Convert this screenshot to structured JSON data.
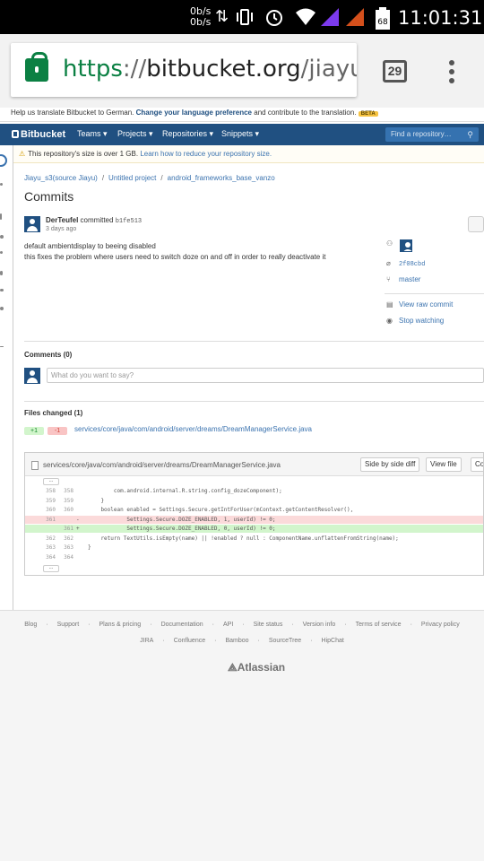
{
  "status_bar": {
    "net_up": "0b/s",
    "net_down": "0b/s",
    "battery": "68",
    "time": "11:01:31",
    "icons": [
      "data-transfer-icon",
      "vibrate-icon",
      "alarm-icon",
      "wifi-icon",
      "signal-icon",
      "signal-icon",
      "battery-icon"
    ]
  },
  "browser": {
    "url_scheme": "https",
    "url_sep": "://",
    "url_host": "bitbucket.org",
    "url_path": "/jiayu_s",
    "tab_count": "29",
    "icons": [
      "lock-icon",
      "menu-dots-icon"
    ]
  },
  "translate_bar": {
    "prefix": "Help us translate Bitbucket to German.",
    "link": "Change your language preference",
    "suffix": "and contribute to the translation.",
    "badge": "BETA"
  },
  "nav": {
    "logo": "Bitbucket",
    "items": [
      "Teams ▾",
      "Projects ▾",
      "Repositories ▾",
      "Snippets ▾"
    ],
    "search_placeholder": "Find a repository…",
    "brand_color": "#205081"
  },
  "warning": {
    "text": "This repository's size is over 1 GB.",
    "link": "Learn how to reduce your repository size."
  },
  "breadcrumb": {
    "items": [
      "Jiayu_s3(source Jiayu)",
      "Untitled project",
      "android_frameworks_base_vanzo"
    ],
    "sep": "/"
  },
  "page_title": "Commits",
  "commit": {
    "author": "DerTeufel",
    "verb": "committed",
    "hash": "b1fe513",
    "date": "3 days ago",
    "message_line1": "default ambientdisplay to beeing disabled",
    "message_line2": "this fixes the problem where users need to switch doze on and off in order to really deactivate it",
    "sidebar": {
      "parent_hash": "2f08cbd",
      "branch": "master",
      "view_raw": "View raw commit",
      "stop_watching": "Stop watching"
    }
  },
  "comments": {
    "heading": "Comments (0)",
    "placeholder": "What do you want to say?"
  },
  "files_changed": {
    "heading": "Files changed (1)",
    "added": "+1",
    "removed": "-1",
    "file": "services/core/java/com/android/server/dreams/DreamManagerService.java"
  },
  "diff": {
    "path": "services/core/java/com/android/server/dreams/DreamManagerService.java",
    "side_by_side": "Side by side diff",
    "view_file": "View file",
    "comment_btn": "Co",
    "ellipsis": "...",
    "lines": [
      {
        "n1": "358",
        "n2": "358",
        "type": "ctx",
        "code": "        com.android.internal.R.string.config_dozeComponent);"
      },
      {
        "n1": "359",
        "n2": "359",
        "type": "ctx",
        "code": "    }"
      },
      {
        "n1": "360",
        "n2": "360",
        "type": "ctx",
        "code": "    boolean enabled = Settings.Secure.getIntForUser(mContext.getContentResolver(),"
      },
      {
        "n1": "361",
        "n2": "",
        "type": "del",
        "code": "            Settings.Secure.DOZE_ENABLED, 1, userId) != 0;"
      },
      {
        "n1": "",
        "n2": "361",
        "type": "add",
        "code": "            Settings.Secure.DOZE_ENABLED, 0, userId) != 0;"
      },
      {
        "n1": "362",
        "n2": "362",
        "type": "ctx",
        "code": "    return TextUtils.isEmpty(name) || !enabled ? null : ComponentName.unflattenFromString(name);"
      },
      {
        "n1": "363",
        "n2": "363",
        "type": "ctx",
        "code": "}"
      },
      {
        "n1": "364",
        "n2": "364",
        "type": "ctx",
        "code": ""
      }
    ]
  },
  "footer": {
    "links_row1": [
      "Blog",
      "Support",
      "Plans & pricing",
      "Documentation",
      "API",
      "Site status",
      "Version info",
      "Terms of service",
      "Privacy policy"
    ],
    "links_row2": [
      "JIRA",
      "Confluence",
      "Bamboo",
      "SourceTree",
      "HipChat"
    ],
    "sep": "·",
    "brand": "Atlassian"
  }
}
